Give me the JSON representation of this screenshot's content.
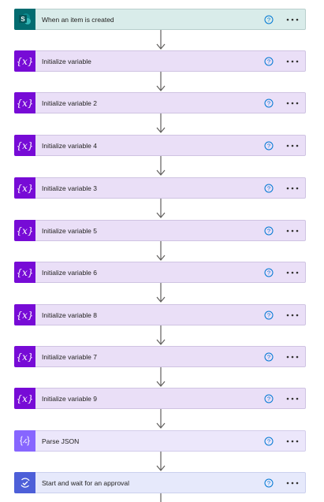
{
  "flow": {
    "steps": [
      {
        "id": "trigger",
        "kind": "sharepoint",
        "title": "When an item is created",
        "icon": "sharepoint-icon"
      },
      {
        "id": "var1",
        "kind": "variable",
        "title": "Initialize variable",
        "icon": "variable-icon"
      },
      {
        "id": "var2",
        "kind": "variable",
        "title": "Initialize variable 2",
        "icon": "variable-icon"
      },
      {
        "id": "var4",
        "kind": "variable",
        "title": "Initialize variable 4",
        "icon": "variable-icon"
      },
      {
        "id": "var3",
        "kind": "variable",
        "title": "Initialize variable 3",
        "icon": "variable-icon"
      },
      {
        "id": "var5",
        "kind": "variable",
        "title": "Initialize variable 5",
        "icon": "variable-icon"
      },
      {
        "id": "var6",
        "kind": "variable",
        "title": "Initialize variable 6",
        "icon": "variable-icon"
      },
      {
        "id": "var8",
        "kind": "variable",
        "title": "Initialize variable 8",
        "icon": "variable-icon"
      },
      {
        "id": "var7",
        "kind": "variable",
        "title": "Initialize variable 7",
        "icon": "variable-icon"
      },
      {
        "id": "var9",
        "kind": "variable",
        "title": "Initialize variable 9",
        "icon": "variable-icon"
      },
      {
        "id": "parse",
        "kind": "parse",
        "title": "Parse JSON",
        "icon": "parse-json-icon"
      },
      {
        "id": "approval",
        "kind": "approval",
        "title": "Start and wait for an approval",
        "icon": "approval-icon"
      }
    ],
    "sharepoint_badge": "S",
    "variable_glyph": "{x}",
    "colors": {
      "sharepoint": "#036c70",
      "variable": "#770bd6",
      "parse": "#8766ff",
      "approval": "#4d5fd8",
      "help": "#0078d4"
    }
  }
}
